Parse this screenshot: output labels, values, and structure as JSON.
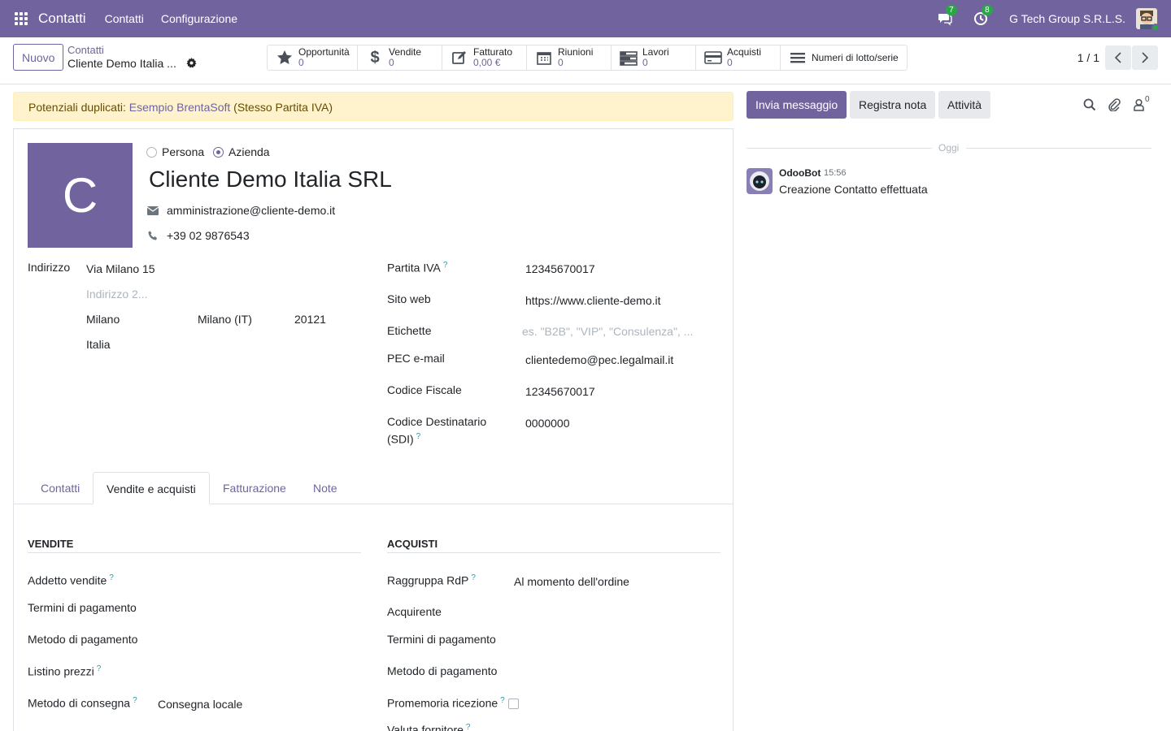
{
  "navbar": {
    "app_name": "Contatti",
    "menus": [
      "Contatti",
      "Configurazione"
    ],
    "messages_count": "7",
    "activities_count": "8",
    "company": "G Tech Group S.R.L.S."
  },
  "control": {
    "new_label": "Nuovo",
    "breadcrumb_parent": "Contatti",
    "breadcrumb_current": "Cliente Demo Italia ...",
    "pager": "1 / 1",
    "smart_buttons": [
      {
        "label": "Opportunità",
        "value": "0",
        "icon": "star-icon"
      },
      {
        "label": "Vendite",
        "value": "0",
        "icon": "dollar-icon"
      },
      {
        "label": "Fatturato",
        "value": "0,00 €",
        "icon": "pencil-square-icon"
      },
      {
        "label": "Riunioni",
        "value": "0",
        "icon": "calendar-icon"
      },
      {
        "label": "Lavori",
        "value": "0",
        "icon": "tasks-icon"
      },
      {
        "label": "Acquisti",
        "value": "0",
        "icon": "credit-card-icon"
      },
      {
        "label": "Numeri di lotto/serie",
        "value": "",
        "icon": "bars-icon"
      }
    ]
  },
  "alert": {
    "prefix": "Potenziali duplicati:",
    "link": "Esempio BrentaSoft",
    "suffix": "(Stesso Partita IVA)"
  },
  "partner": {
    "avatar_letter": "C",
    "type_person": "Persona",
    "type_company": "Azienda",
    "selected_type": "Azienda",
    "name": "Cliente Demo Italia SRL",
    "email": "amministrazione@cliente-demo.it",
    "phone": "+39 02 9876543"
  },
  "address": {
    "label": "Indirizzo",
    "street": "Via Milano 15",
    "street2_placeholder": "Indirizzo 2...",
    "city": "Milano",
    "state": "Milano (IT)",
    "zip": "20121",
    "country": "Italia"
  },
  "right_fields": {
    "vat_label": "Partita IVA",
    "vat": "12345670017",
    "website_label": "Sito web",
    "website": "https://www.cliente-demo.it",
    "tags_label": "Etichette",
    "tags_placeholder": "es. \"B2B\", \"VIP\", \"Consulenza\", ...",
    "pec_label": "PEC e-mail",
    "pec": "clientedemo@pec.legalmail.it",
    "fiscal_label": "Codice Fiscale",
    "fiscal": "12345670017",
    "sdi_label_1": "Codice Destinatario",
    "sdi_label_2": "(SDI)",
    "sdi": "0000000"
  },
  "tabs": [
    "Contatti",
    "Vendite e acquisti",
    "Fatturazione",
    "Note"
  ],
  "active_tab": "Vendite e acquisti",
  "sales": {
    "title": "VENDITE",
    "salesperson": "Addetto vendite",
    "payment_terms": "Termini di pagamento",
    "payment_method": "Metodo di pagamento",
    "pricelist": "Listino prezzi",
    "delivery_label": "Metodo di consegna",
    "delivery_value": "Consegna locale"
  },
  "purchases": {
    "title": "ACQUISTI",
    "group_rdp_label": "Raggruppa RdP",
    "group_rdp_value": "Al momento dell'ordine",
    "buyer": "Acquirente",
    "payment_terms": "Termini di pagamento",
    "payment_method": "Metodo di pagamento",
    "receipt_reminder": "Promemoria ricezione",
    "receipt_reminder_checked": false,
    "supplier_currency": "Valuta fornitore"
  },
  "chatter": {
    "send_message": "Invia messaggio",
    "log_note": "Registra nota",
    "activities": "Attività",
    "followers_count": "0",
    "today": "Oggi",
    "message_author": "OdooBot",
    "message_time": "15:56",
    "message_body": "Creazione Contatto effettuata"
  },
  "colors": {
    "brand": "#71639e",
    "alert_bg": "#fff3cd",
    "badge": "#28a745",
    "link": "#71639e"
  }
}
